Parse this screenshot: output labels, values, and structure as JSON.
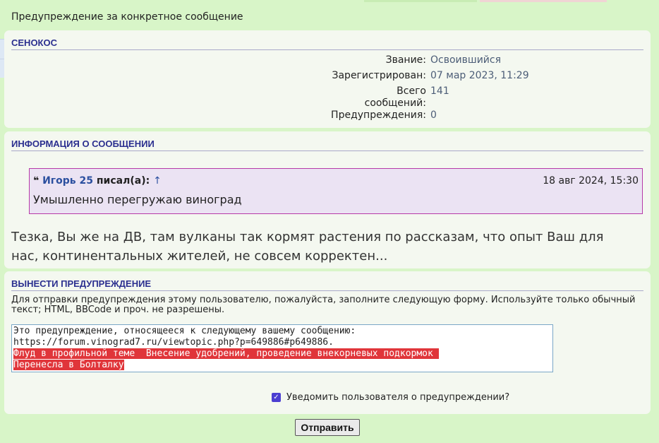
{
  "page": {
    "title": "Предупреждение за конкретное сообщение"
  },
  "user": {
    "heading": "СЕНОКОС",
    "fields": [
      {
        "label": "Звание:",
        "value": "Освоившийся"
      },
      {
        "label": "Зарегистрирован:",
        "value": "07 мар 2023, 11:29"
      },
      {
        "label": "Всего сообщений:",
        "value": "141"
      },
      {
        "label": "Предупреждения:",
        "value": "0"
      }
    ]
  },
  "post_info": {
    "heading": "ИНФОРМАЦИЯ О СООБЩЕНИИ",
    "quote": {
      "author": "Игорь 25",
      "wrote": "писал(а):",
      "arrow": "↑",
      "date": "18 авг 2024, 15:30",
      "text": "Умышленно перегружаю виноград"
    },
    "body": "Тезка, Вы же на ДВ, там вулканы так кормят растения по рассказам, что опыт Ваш для нас, континентальных жителей, не совсем корректен..."
  },
  "warn": {
    "heading": "ВЫНЕСТИ ПРЕДУПРЕЖДЕНИЕ",
    "help": "Для отправки предупреждения этому пользователю, пожалуйста, заполните следующую форму. Используйте только обычный текст; HTML, BBCode и проч. не разрешены.",
    "message_lines": [
      "Это предупреждение, относящееся к следующему вашему сообщению:",
      "https://forum.vinograd7.ru/viewtopic.php?p=649886#p649886.",
      "Флуд в профильной теме  Внесение удобрений, проведение внекорневых подкормок ",
      "Перенесла в Болталку"
    ],
    "notify_label": "Уведомить пользователя о предупреждении?",
    "notify_checked": true,
    "submit_label": "Отправить"
  },
  "colors": {
    "accent": "#2b2f8f",
    "quote_border": "#b63aa9",
    "highlight": "#e0353a",
    "checkbox": "#4b3fd1"
  }
}
